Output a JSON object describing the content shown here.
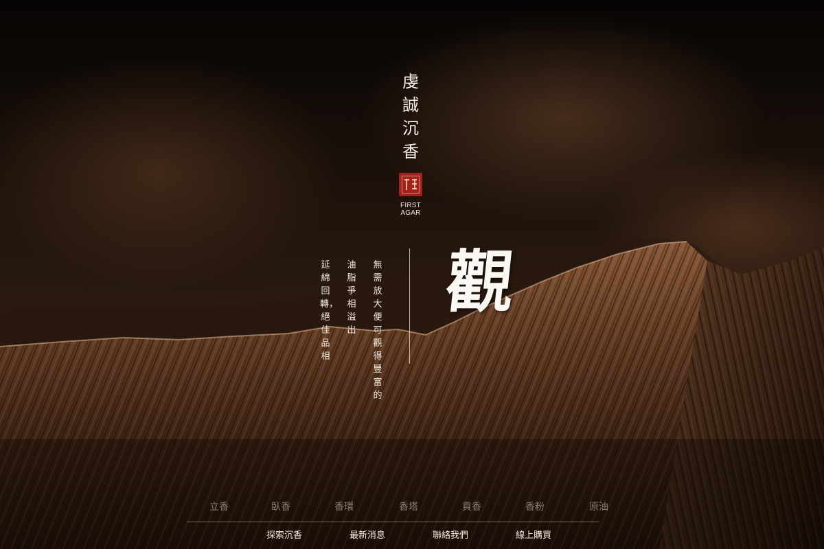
{
  "brand": {
    "title": "虔誠沉香",
    "seal_icon": "red-square-seal-icon",
    "seal_color": "#a5211c",
    "subtitle": "FIRST\nAGAR"
  },
  "hero": {
    "character": "觀",
    "poem": [
      "無需放大便可觀得豐富的",
      "油脂爭相溢出",
      "延綿回轉，絕佳品相"
    ]
  },
  "product_nav": {
    "items": [
      "立香",
      "臥香",
      "香環",
      "香塔",
      "貢香",
      "香粉",
      "原油"
    ]
  },
  "main_nav": {
    "items": [
      "探索沉香",
      "最新消息",
      "聯絡我們",
      "線上購買"
    ]
  },
  "colors": {
    "text": "#f3ece4",
    "background": "#1d120b"
  }
}
